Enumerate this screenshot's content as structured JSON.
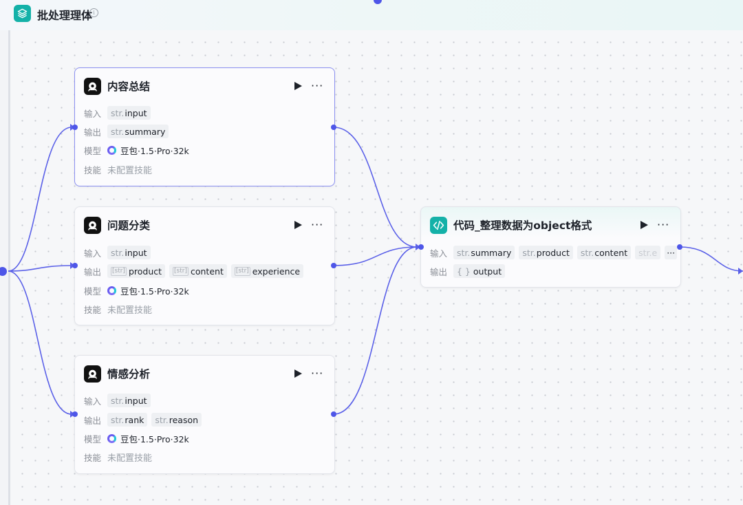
{
  "header": {
    "title": "批处理理体",
    "info_icon": "i"
  },
  "colors": {
    "accent": "#4e56e8",
    "teal": "#14b1a8",
    "edge": "#5a60e8"
  },
  "nodes": [
    {
      "title": "内容总结",
      "input_label": "输入",
      "inputs": [
        {
          "prefix": "str.",
          "name": "input"
        }
      ],
      "output_label": "输出",
      "outputs": [
        {
          "prefix": "str.",
          "name": "summary"
        }
      ],
      "model_label": "模型",
      "model": "豆包·1.5·Pro·32k",
      "skill_label": "技能",
      "skill": "未配置技能"
    },
    {
      "title": "问题分类",
      "input_label": "输入",
      "inputs": [
        {
          "prefix": "str.",
          "name": "input"
        }
      ],
      "output_label": "输出",
      "outputs": [
        {
          "prefix": "[str]",
          "name": "product"
        },
        {
          "prefix": "[str]",
          "name": "content"
        },
        {
          "prefix": "[str]",
          "name": "experience"
        }
      ],
      "model_label": "模型",
      "model": "豆包·1.5·Pro·32k",
      "skill_label": "技能",
      "skill": "未配置技能"
    },
    {
      "title": "情感分析",
      "input_label": "输入",
      "inputs": [
        {
          "prefix": "str.",
          "name": "input"
        }
      ],
      "output_label": "输出",
      "outputs": [
        {
          "prefix": "str.",
          "name": "rank"
        },
        {
          "prefix": "str.",
          "name": "reason"
        }
      ],
      "model_label": "模型",
      "model": "豆包·1.5·Pro·32k",
      "skill_label": "技能",
      "skill": "未配置技能"
    }
  ],
  "code_node": {
    "title": "代码_整理数据为object格式",
    "input_label": "输入",
    "inputs": [
      {
        "prefix": "str.",
        "name": "summary"
      },
      {
        "prefix": "str.",
        "name": "product"
      },
      {
        "prefix": "str.",
        "name": "content"
      },
      {
        "prefix": "str.",
        "name": "e"
      }
    ],
    "more": "···",
    "output_label": "输出",
    "outputs": [
      {
        "prefix": "{ }",
        "name": "output"
      }
    ]
  }
}
